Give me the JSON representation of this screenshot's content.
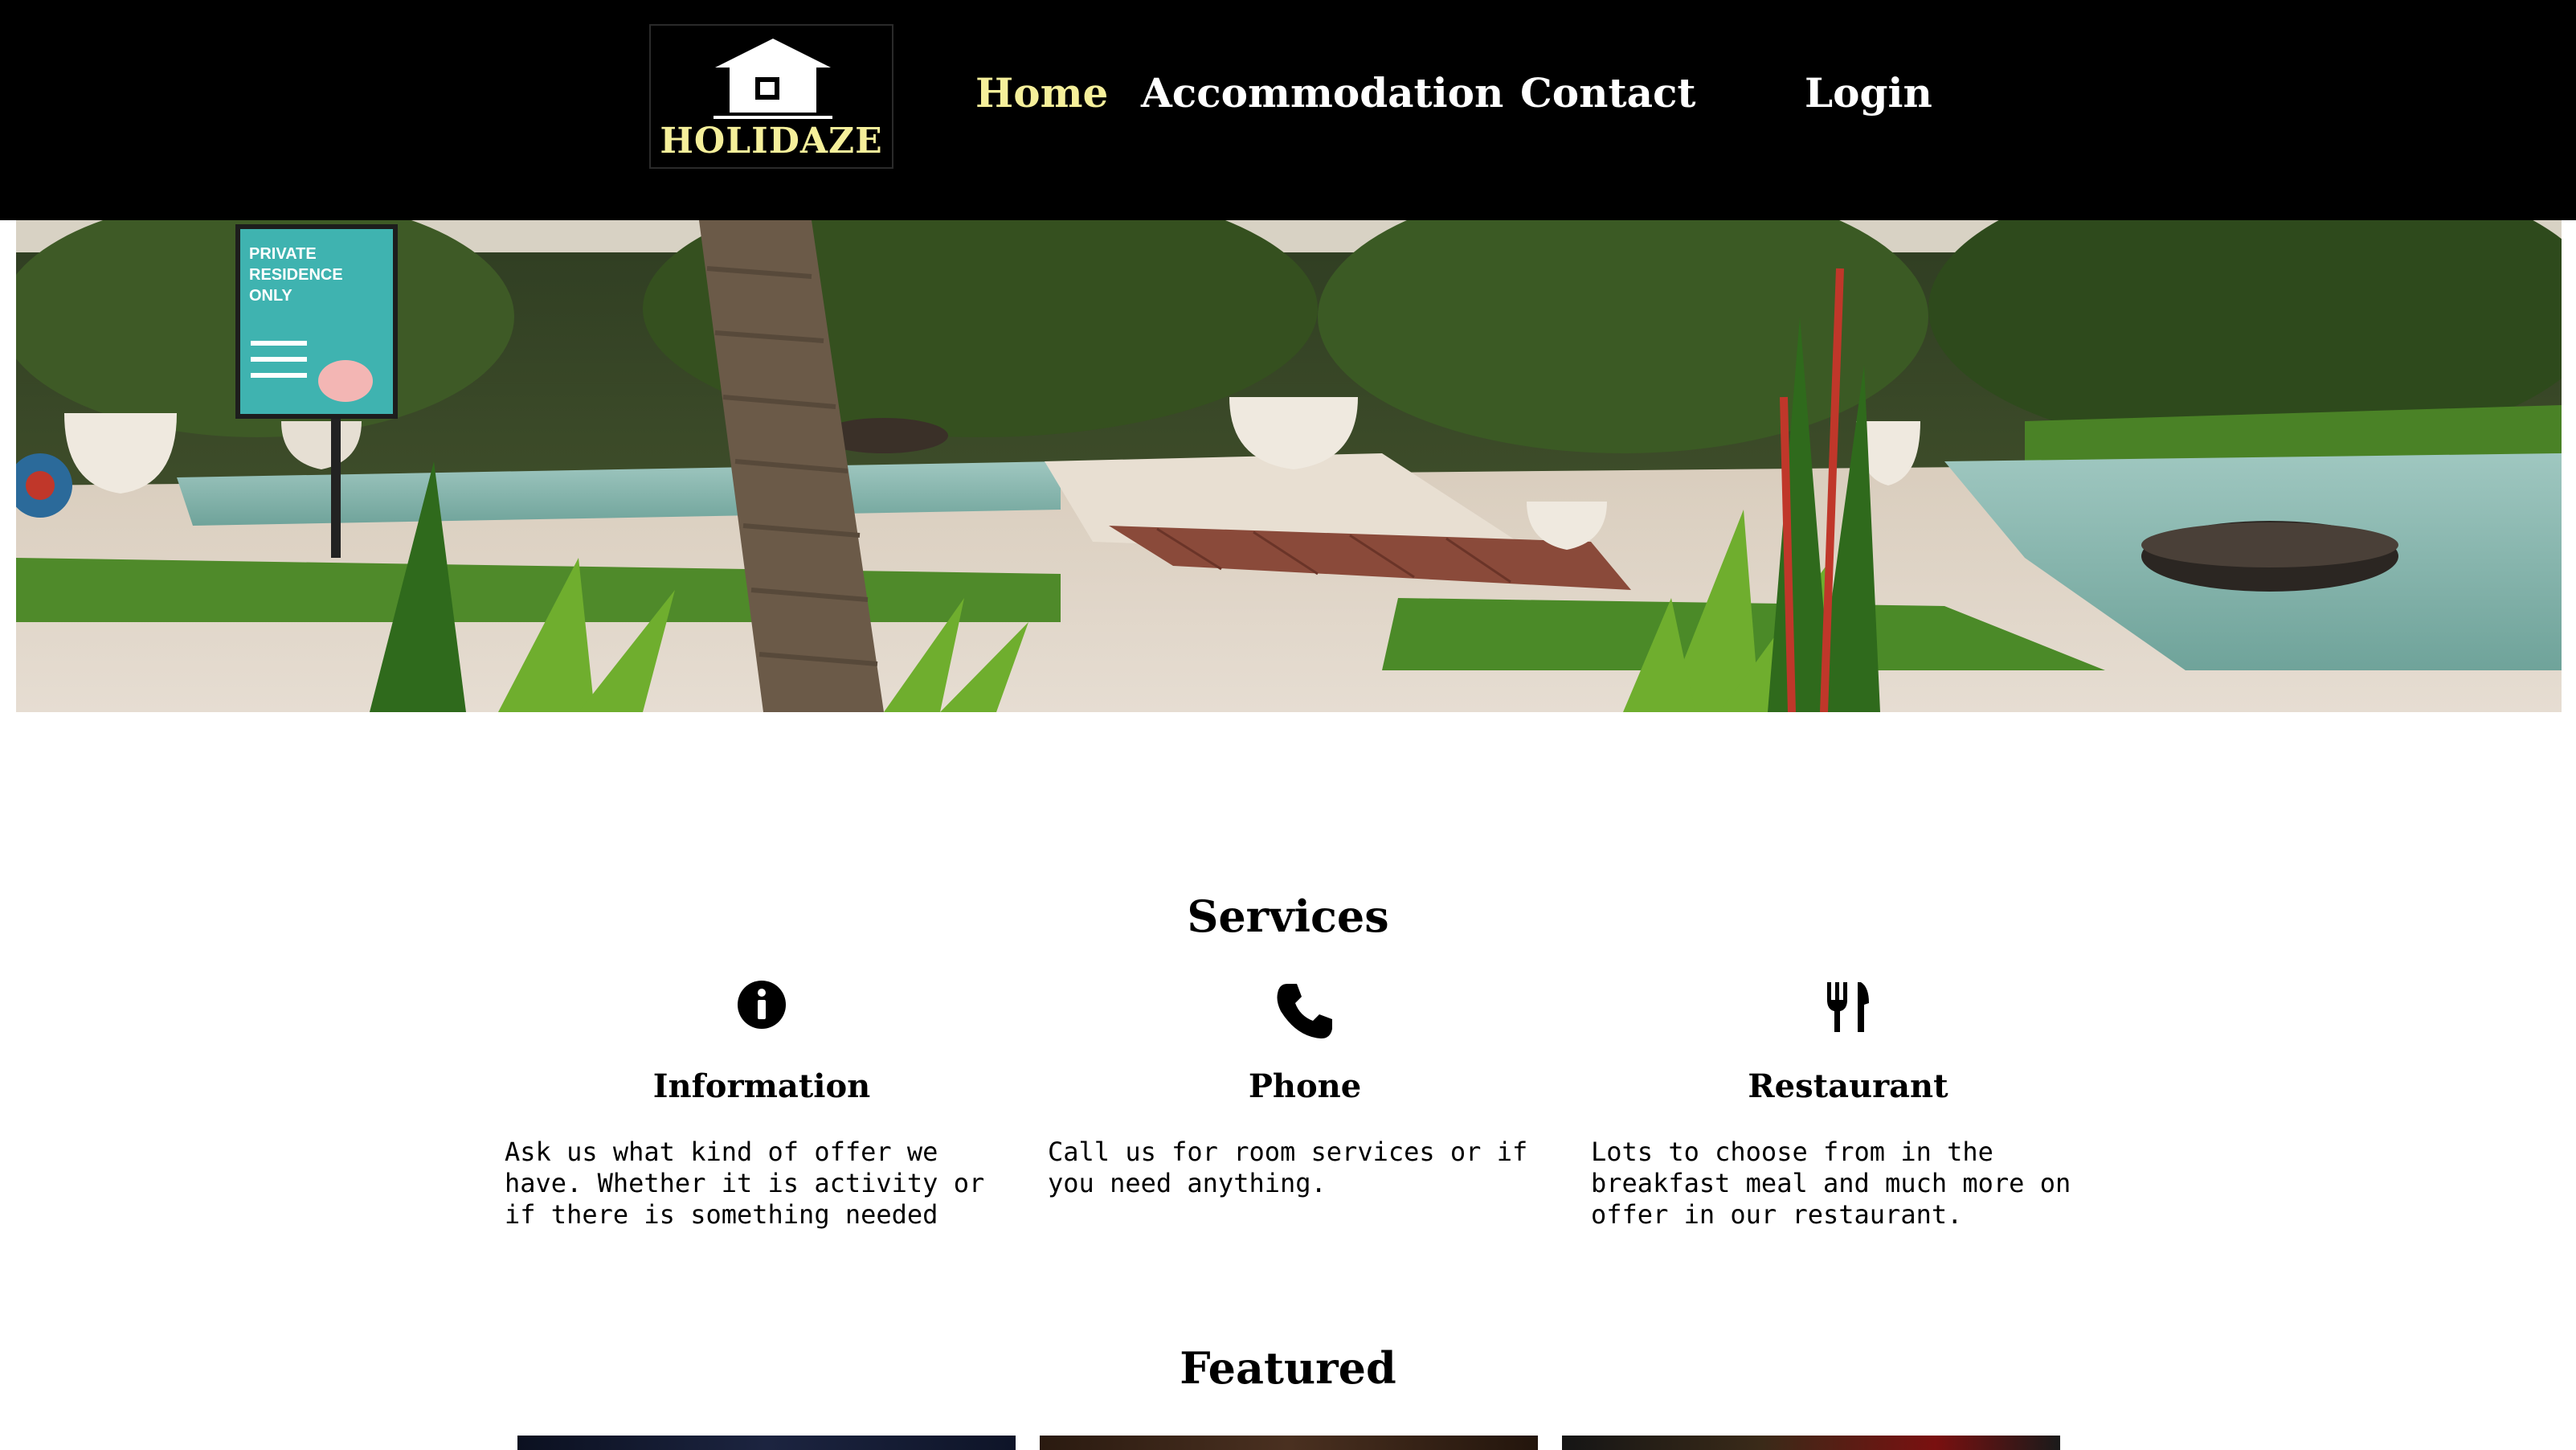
{
  "brand": {
    "name": "HOLIDAZE",
    "logo_color": "#f5ef9a"
  },
  "nav": {
    "items": [
      {
        "label": "Home",
        "active": true
      },
      {
        "label": "Accommodation",
        "active": false
      },
      {
        "label": "Contact",
        "active": false
      }
    ],
    "login_label": "Login"
  },
  "hero": {
    "sign_text": "PRIVATE RESIDENCE ONLY"
  },
  "services": {
    "title": "Services",
    "items": [
      {
        "icon": "info-icon",
        "title": "Information",
        "text": "Ask us what kind of offer we have. Whether it is activity or if there is something needed"
      },
      {
        "icon": "phone-icon",
        "title": "Phone",
        "text": "Call us for room services or if you need anything."
      },
      {
        "icon": "fork-knife-icon",
        "title": "Restaurant",
        "text": "Lots to choose from in the breakfast meal and much more on offer in our restaurant."
      }
    ]
  },
  "featured": {
    "title": "Featured"
  },
  "colors": {
    "header_bg": "#000000",
    "nav_active": "#f5ef9a",
    "nav_text": "#ffffff",
    "body_text": "#000000"
  }
}
